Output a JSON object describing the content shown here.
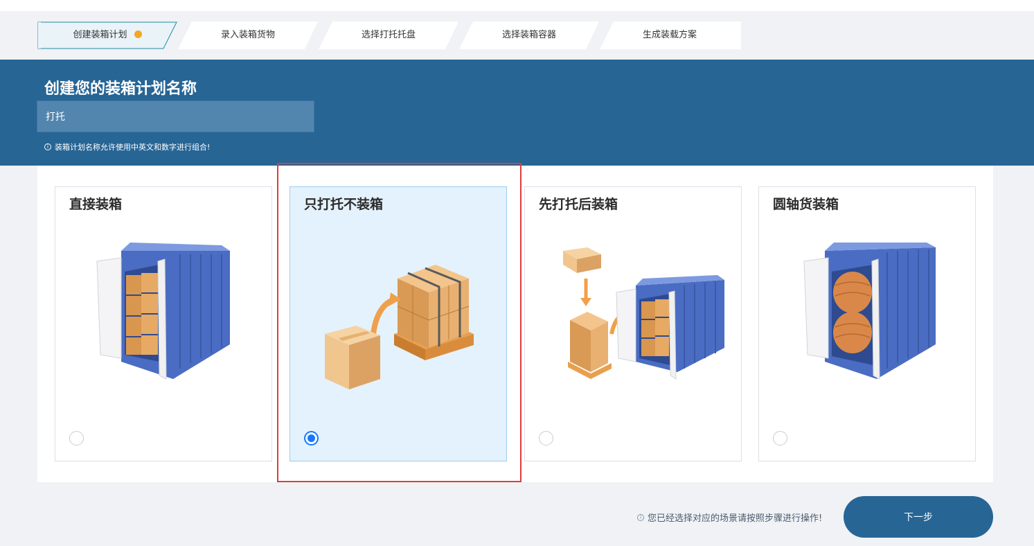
{
  "steps": [
    {
      "label": "创建装箱计划",
      "active": true
    },
    {
      "label": "录入装箱货物",
      "active": false
    },
    {
      "label": "选择打托托盘",
      "active": false
    },
    {
      "label": "选择装箱容器",
      "active": false
    },
    {
      "label": "生成装载方案",
      "active": false
    }
  ],
  "banner": {
    "title": "创建您的装箱计划名称",
    "input_value": "打托",
    "hint": "装箱计划名称允许使用中英文和数字进行组合!"
  },
  "cards": [
    {
      "title": "直接装箱",
      "selected": false
    },
    {
      "title": "只打托不装箱",
      "selected": true
    },
    {
      "title": "先打托后装箱",
      "selected": false
    },
    {
      "title": "圆轴货装箱",
      "selected": false
    }
  ],
  "footer": {
    "hint": "您已经选择对应的场景请按照步骤进行操作!",
    "next_label": "下一步"
  },
  "colors": {
    "primary": "#276595",
    "accent_dot": "#f5a623",
    "selected_bg": "#e4f2fd",
    "radio_blue": "#1677ff",
    "highlight_red": "#e03c3c"
  }
}
